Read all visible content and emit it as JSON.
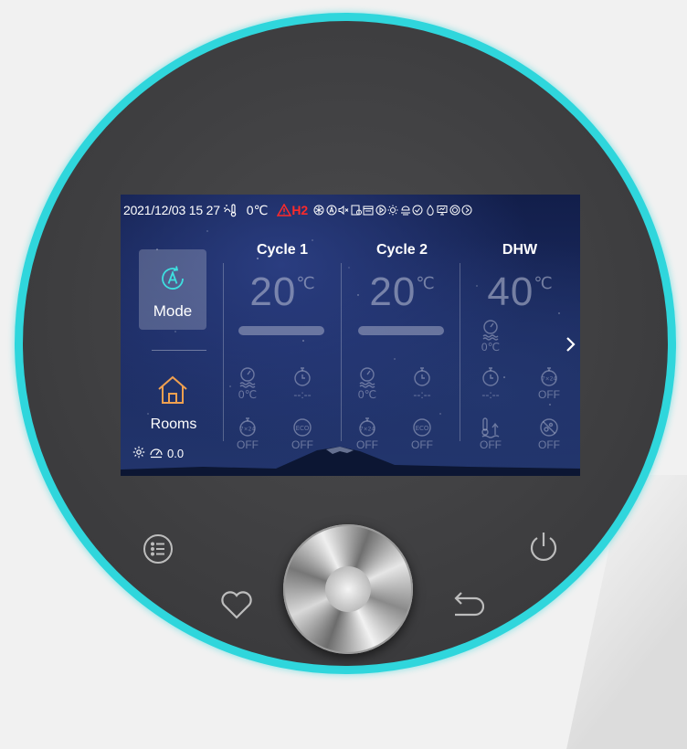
{
  "status_bar": {
    "datetime": "2021/12/03 15 27",
    "outdoor_temp": "0℃",
    "alarm_code": "H2",
    "icons": [
      "outdoor-temp-icon",
      "warning-icon",
      "snowflake-icon",
      "auto-mode-icon",
      "mute-icon",
      "timer-icon",
      "schedule-icon",
      "play-icon",
      "sun-icon",
      "solar-icon",
      "check-icon",
      "drop-icon",
      "monitor-icon",
      "bivalent-icon",
      "play-circle-icon"
    ]
  },
  "left_panel": {
    "mode_label": "Mode",
    "rooms_label": "Rooms",
    "meter_value": "0.0"
  },
  "columns": [
    {
      "title": "Cycle 1",
      "temp": "20",
      "unit": "℃",
      "features": [
        {
          "icon": "gauge-water-icon",
          "value": "0℃"
        },
        {
          "icon": "timer-icon",
          "value": "--:--"
        },
        {
          "icon": "weekly-timer-icon",
          "value": "OFF"
        },
        {
          "icon": "eco-icon",
          "value": "OFF"
        }
      ]
    },
    {
      "title": "Cycle 2",
      "temp": "20",
      "unit": "℃",
      "features": [
        {
          "icon": "gauge-water-icon",
          "value": "0℃"
        },
        {
          "icon": "timer-icon",
          "value": "--:--"
        },
        {
          "icon": "weekly-timer-icon",
          "value": "OFF"
        },
        {
          "icon": "eco-icon",
          "value": "OFF"
        }
      ]
    },
    {
      "title": "DHW",
      "temp": "40",
      "unit": "℃",
      "features": [
        {
          "icon": "gauge-water-icon",
          "value": "0℃"
        },
        {
          "icon": "timer-icon",
          "value": "--:--"
        },
        {
          "icon": "weekly-timer-icon",
          "value": "OFF"
        },
        {
          "icon": "fast-heat-icon",
          "value": "OFF"
        },
        {
          "icon": "disinfect-icon",
          "value": "OFF"
        }
      ]
    }
  ],
  "colors": {
    "ring": "#2fd6dc",
    "alarm": "#ff2a2a",
    "body": "#3f3f41"
  }
}
